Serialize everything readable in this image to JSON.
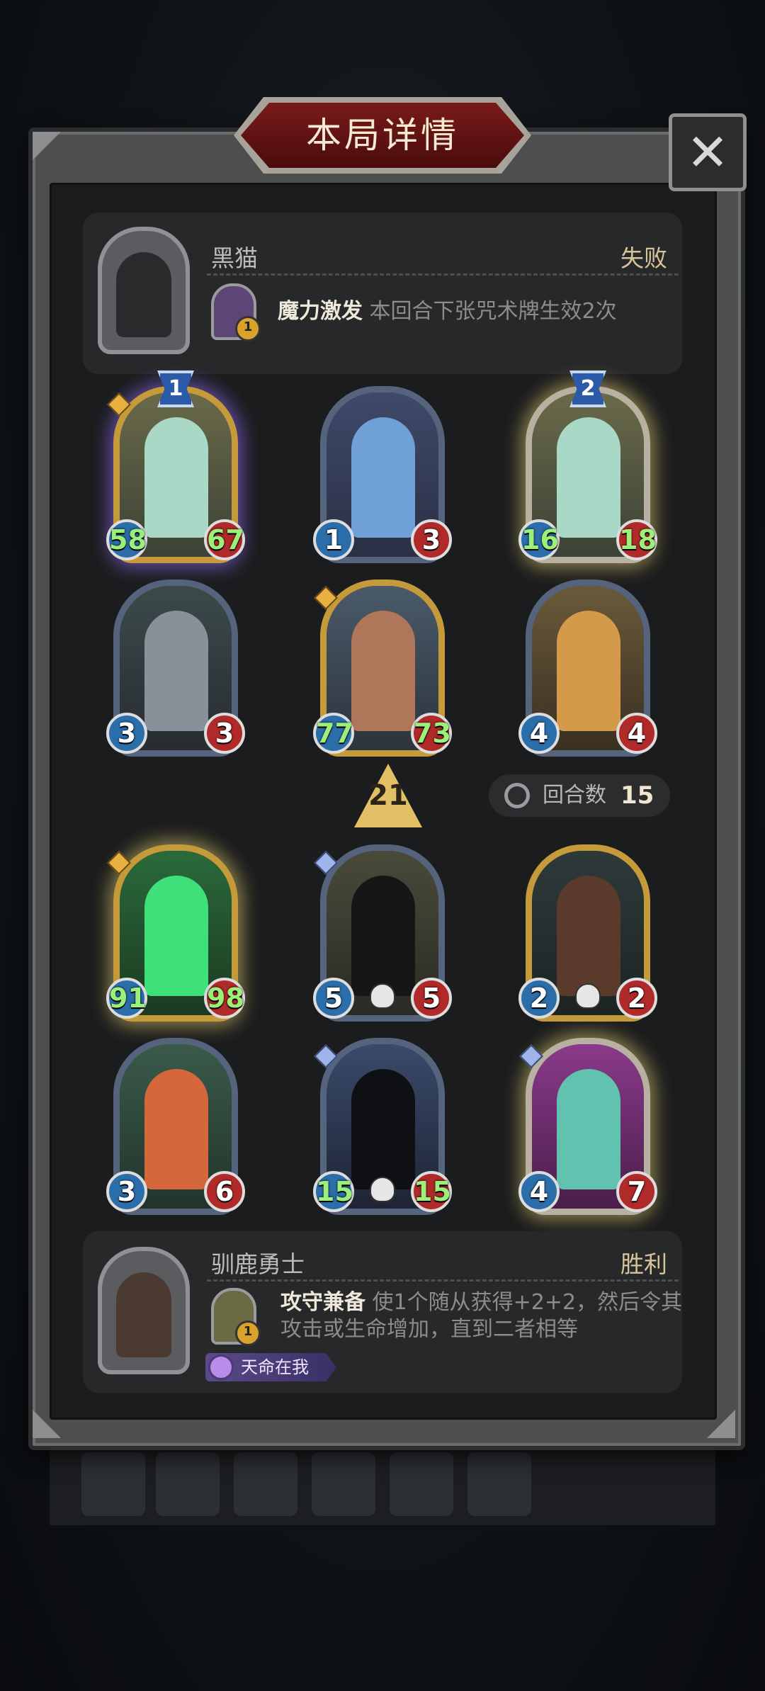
{
  "title": "本局详情",
  "close_label": "✕",
  "opponent": {
    "name": "黑猫",
    "result": "失败",
    "hero_power_level": "1",
    "skill_name": "魔力激发",
    "skill_desc": "本回合下张咒术牌生效2次"
  },
  "opponent_board": [
    {
      "attack": "58",
      "health": "67",
      "level": "1"
    },
    {
      "attack": "1",
      "health": "3"
    },
    {
      "attack": "16",
      "health": "18",
      "level": "2"
    },
    {
      "attack": "3",
      "health": "3"
    },
    {
      "attack": "77",
      "health": "73"
    },
    {
      "attack": "4",
      "health": "4"
    }
  ],
  "tavern_tier": "21",
  "rounds": {
    "label": "回合数",
    "value": "15"
  },
  "player_board": [
    {
      "attack": "91",
      "health": "98"
    },
    {
      "attack": "5",
      "health": "5"
    },
    {
      "attack": "2",
      "health": "2"
    },
    {
      "attack": "3",
      "health": "6"
    },
    {
      "attack": "15",
      "health": "15"
    },
    {
      "attack": "4",
      "health": "7"
    }
  ],
  "player": {
    "name": "驯鹿勇士",
    "result": "胜利",
    "hero_power_level": "1",
    "skill_name": "攻守兼备",
    "skill_desc_line1": "使1个随从获得+2+2，然后令其",
    "skill_desc_line2": "攻击或生命增加，直到二者相等",
    "badge": "天命在我"
  },
  "colors": {
    "loss": "#d8c49a",
    "win": "#d8c49a",
    "buffed_stat": "#9cf07a"
  }
}
